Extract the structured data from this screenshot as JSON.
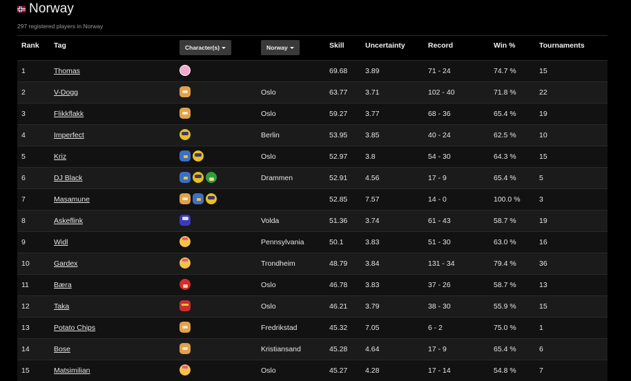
{
  "header": {
    "title": "Norway",
    "flag_icon": "norway-flag-icon",
    "subtitle": "297 registered players in Norway"
  },
  "columns": {
    "rank": "Rank",
    "tag": "Tag",
    "characters_button": "Character(s)",
    "region_button": "Norway",
    "skill": "Skill",
    "uncertainty": "Uncertainty",
    "record": "Record",
    "win_pct": "Win %",
    "tournaments": "Tournaments"
  },
  "colors": {
    "background": "#000000",
    "row_odd": "#121212",
    "row_even": "#1b1b1b",
    "button": "#3a3a3a",
    "text": "#e6e6e6"
  },
  "players": [
    {
      "rank": "1",
      "tag": "Thomas",
      "characters": [
        "jigglypuff-icon"
      ],
      "location": "",
      "skill": "69.68",
      "uncertainty": "3.89",
      "record": "71 - 24",
      "win": "74.7 %",
      "tournaments": "15"
    },
    {
      "rank": "2",
      "tag": "V-Dogg",
      "characters": [
        "fox-icon"
      ],
      "location": "Oslo",
      "skill": "63.77",
      "uncertainty": "3.71",
      "record": "102 - 40",
      "win": "71.8 %",
      "tournaments": "22"
    },
    {
      "rank": "3",
      "tag": "Flikkflakk",
      "characters": [
        "fox-icon"
      ],
      "location": "Oslo",
      "skill": "59.27",
      "uncertainty": "3.77",
      "record": "68 - 36",
      "win": "65.4 %",
      "tournaments": "19"
    },
    {
      "rank": "4",
      "tag": "Imperfect",
      "characters": [
        "sheik-icon"
      ],
      "location": "Berlin",
      "skill": "53.95",
      "uncertainty": "3.85",
      "record": "40 - 24",
      "win": "62.5 %",
      "tournaments": "10"
    },
    {
      "rank": "5",
      "tag": "Kriz",
      "characters": [
        "falco-icon",
        "sheik-icon"
      ],
      "location": "Oslo",
      "skill": "52.97",
      "uncertainty": "3.8",
      "record": "54 - 30",
      "win": "64.3 %",
      "tournaments": "15"
    },
    {
      "rank": "6",
      "tag": "DJ Black",
      "characters": [
        "falco-icon",
        "sheik-icon",
        "luigi-icon"
      ],
      "location": "Drammen",
      "skill": "52.91",
      "uncertainty": "4.56",
      "record": "17 - 9",
      "win": "65.4 %",
      "tournaments": "5"
    },
    {
      "rank": "7",
      "tag": "Masamune",
      "characters": [
        "fox-icon",
        "falco-icon",
        "sheik-icon"
      ],
      "location": "",
      "skill": "52.85",
      "uncertainty": "7.57",
      "record": "14 - 0",
      "win": "100.0 %",
      "tournaments": "3"
    },
    {
      "rank": "8",
      "tag": "Askeflink",
      "characters": [
        "marth-icon"
      ],
      "location": "Volda",
      "skill": "51.36",
      "uncertainty": "3.74",
      "record": "61 - 43",
      "win": "58.7 %",
      "tournaments": "19"
    },
    {
      "rank": "9",
      "tag": "Widl",
      "characters": [
        "peach-icon"
      ],
      "location": "Pennsylvania",
      "skill": "50.1",
      "uncertainty": "3.83",
      "record": "51 - 30",
      "win": "63.0 %",
      "tournaments": "16"
    },
    {
      "rank": "10",
      "tag": "Gardex",
      "characters": [
        "peach-icon"
      ],
      "location": "Trondheim",
      "skill": "48.79",
      "uncertainty": "3.84",
      "record": "131 - 34",
      "win": "79.4 %",
      "tournaments": "36"
    },
    {
      "rank": "11",
      "tag": "Bæra",
      "characters": [
        "mario-icon"
      ],
      "location": "Oslo",
      "skill": "46.78",
      "uncertainty": "3.83",
      "record": "37 - 26",
      "win": "58.7 %",
      "tournaments": "13"
    },
    {
      "rank": "12",
      "tag": "Taka",
      "characters": [
        "captain-falcon-icon"
      ],
      "location": "Oslo",
      "skill": "46.21",
      "uncertainty": "3.79",
      "record": "38 - 30",
      "win": "55.9 %",
      "tournaments": "15"
    },
    {
      "rank": "13",
      "tag": "Potato Chips",
      "characters": [
        "fox-icon"
      ],
      "location": "Fredrikstad",
      "skill": "45.32",
      "uncertainty": "7.05",
      "record": "6 - 2",
      "win": "75.0 %",
      "tournaments": "1"
    },
    {
      "rank": "14",
      "tag": "Bose",
      "characters": [
        "fox-icon"
      ],
      "location": "Kristiansand",
      "skill": "45.28",
      "uncertainty": "4.64",
      "record": "17 - 9",
      "win": "65.4 %",
      "tournaments": "6"
    },
    {
      "rank": "15",
      "tag": "Matsimilian",
      "characters": [
        "peach-icon"
      ],
      "location": "Oslo",
      "skill": "45.27",
      "uncertainty": "4.28",
      "record": "17 - 14",
      "win": "54.8 %",
      "tournaments": "7"
    }
  ]
}
